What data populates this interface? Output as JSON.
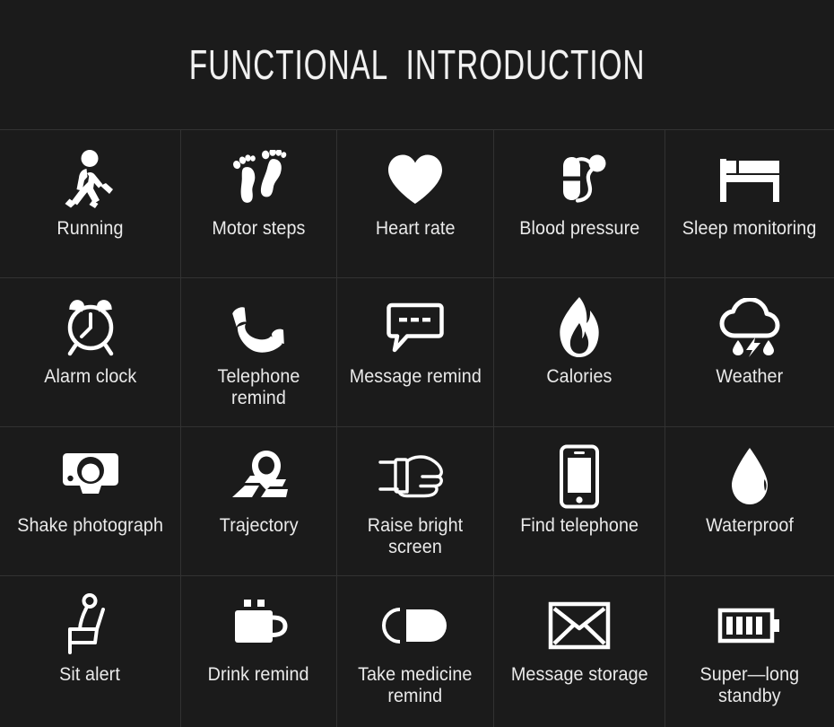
{
  "header": {
    "title": "FUNCTIONAL  INTRODUCTION"
  },
  "theme": {
    "background": "#1b1b1b",
    "divider": "#323232",
    "text": "#eaeaea",
    "icon": "#ffffff"
  },
  "grid": {
    "columns": 5,
    "rows": 4,
    "features": [
      {
        "label": "Running",
        "icon": "walking-person-icon"
      },
      {
        "label": "Motor steps",
        "icon": "footprints-icon"
      },
      {
        "label": "Heart rate",
        "icon": "heart-icon"
      },
      {
        "label": "Blood pressure",
        "icon": "blood-pressure-cuff-icon"
      },
      {
        "label": "Sleep monitoring",
        "icon": "bed-icon"
      },
      {
        "label": "Alarm clock",
        "icon": "alarm-clock-icon"
      },
      {
        "label": "Telephone remind",
        "icon": "phone-handset-icon"
      },
      {
        "label": "Message remind",
        "icon": "speech-bubble-icon"
      },
      {
        "label": "Calories",
        "icon": "flame-icon"
      },
      {
        "label": "Weather",
        "icon": "storm-cloud-icon"
      },
      {
        "label": "Shake photograph",
        "icon": "camera-icon"
      },
      {
        "label": "Trajectory",
        "icon": "map-pin-route-icon"
      },
      {
        "label": "Raise bright screen",
        "icon": "wrist-watch-hand-icon"
      },
      {
        "label": "Find telephone",
        "icon": "smartphone-icon"
      },
      {
        "label": "Waterproof",
        "icon": "water-drop-icon"
      },
      {
        "label": "Sit alert",
        "icon": "seated-person-icon"
      },
      {
        "label": "Drink remind",
        "icon": "coffee-mug-icon"
      },
      {
        "label": "Take medicine\nremind",
        "icon": "pill-capsule-icon"
      },
      {
        "label": "Message storage",
        "icon": "envelope-icon"
      },
      {
        "label": "Super—long\nstandby",
        "icon": "battery-full-icon"
      }
    ]
  }
}
